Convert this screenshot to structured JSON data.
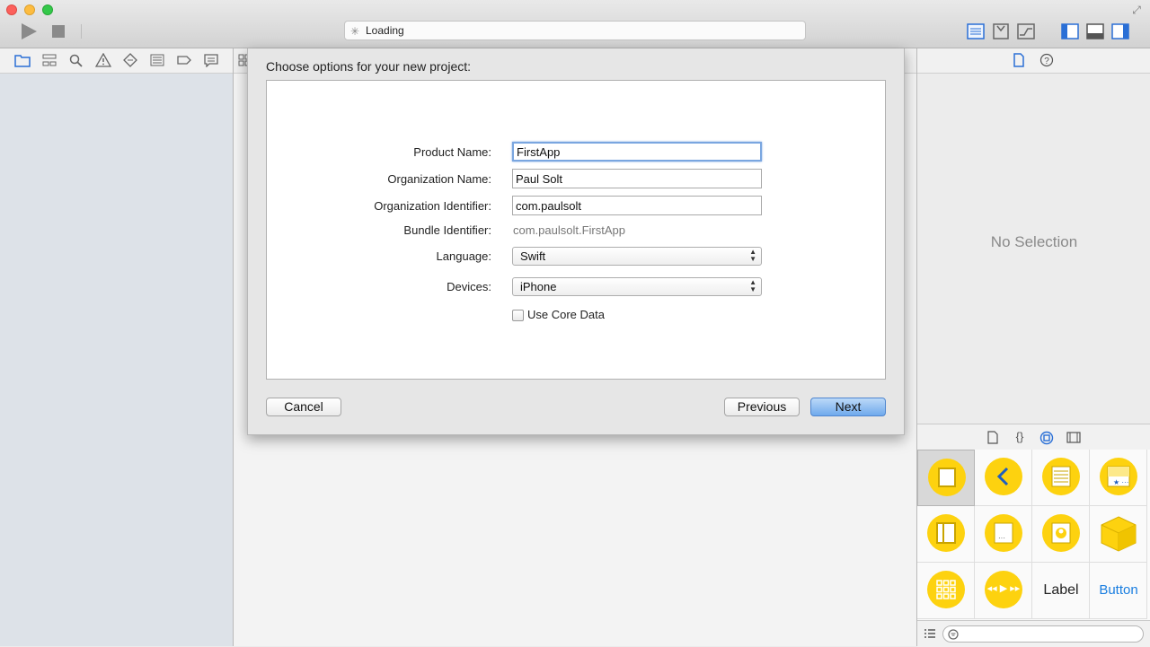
{
  "toolbar": {
    "activity_text": "Loading",
    "window_buttons": [
      "close",
      "minimize",
      "zoom"
    ],
    "editor_icons": [
      "standard-editor-icon",
      "assistant-editor-icon",
      "version-editor-icon"
    ],
    "view_icons": [
      "navigator-toggle-icon",
      "debug-area-toggle-icon",
      "utilities-toggle-icon"
    ]
  },
  "navigator": {
    "icons": [
      "folder-icon",
      "hierarchy-icon",
      "search-icon",
      "warning-icon",
      "test-icon",
      "debug-icon",
      "breakpoint-icon",
      "report-icon"
    ]
  },
  "sheet": {
    "title": "Choose options for your new project:",
    "fields": {
      "product_name": {
        "label": "Product Name:",
        "value": "FirstApp"
      },
      "organization_name": {
        "label": "Organization Name:",
        "value": "Paul Solt"
      },
      "organization_identifier": {
        "label": "Organization Identifier:",
        "value": "com.paulsolt"
      },
      "bundle_identifier": {
        "label": "Bundle Identifier:",
        "value": "com.paulsolt.FirstApp"
      },
      "language": {
        "label": "Language:",
        "value": "Swift"
      },
      "devices": {
        "label": "Devices:",
        "value": "iPhone"
      },
      "use_core_data": {
        "label": "Use Core Data",
        "checked": false
      }
    },
    "buttons": {
      "cancel": "Cancel",
      "previous": "Previous",
      "next": "Next"
    }
  },
  "inspector": {
    "no_selection": "No Selection"
  },
  "library": {
    "tabs": [
      "file-template-icon",
      "code-snippet-icon",
      "object-library-icon",
      "media-library-icon"
    ],
    "items": [
      {
        "icon": "view-controller-icon"
      },
      {
        "icon": "navigation-controller-icon"
      },
      {
        "icon": "table-view-controller-icon"
      },
      {
        "icon": "tab-bar-controller-icon"
      },
      {
        "icon": "split-view-controller-icon"
      },
      {
        "icon": "page-view-controller-icon"
      },
      {
        "icon": "glkit-view-controller-icon"
      },
      {
        "icon": "object-icon"
      },
      {
        "icon": "collection-view-controller-icon"
      },
      {
        "icon": "av-player-view-controller-icon"
      },
      {
        "text": "Label"
      },
      {
        "text": "Button"
      }
    ]
  },
  "colors": {
    "accent": "#fdd20f",
    "button_blue": "#1a7ee0",
    "next_button": "#6fa9ec"
  }
}
